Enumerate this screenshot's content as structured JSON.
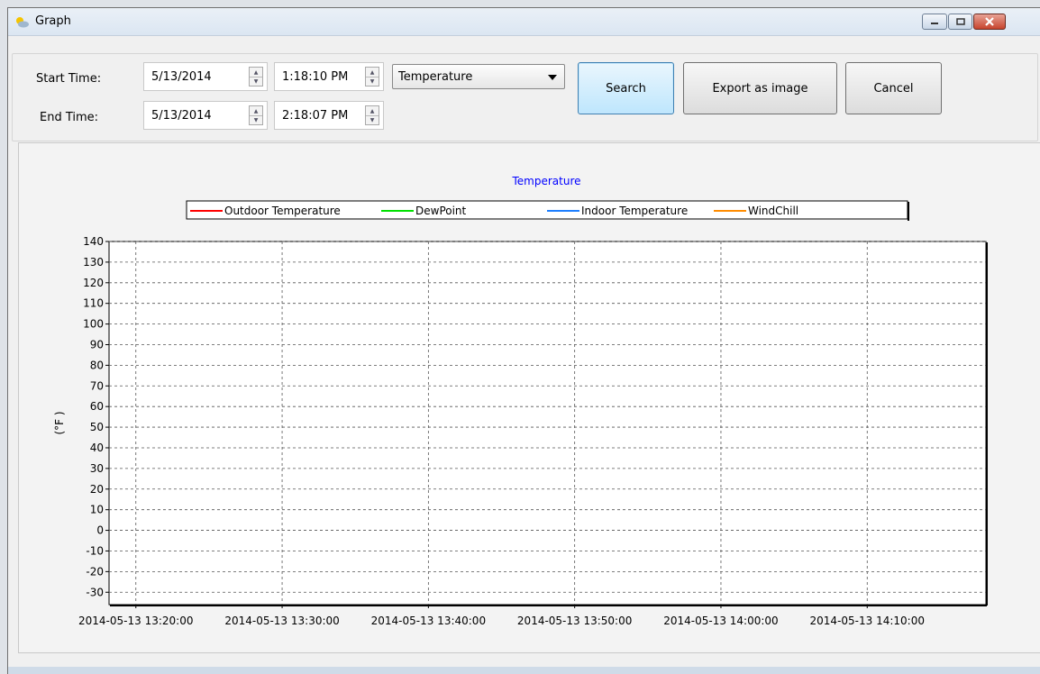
{
  "window": {
    "title": "Graph"
  },
  "controls": {
    "start_label": "Start Time:",
    "end_label": "End Time:",
    "start_date": "5/13/2014",
    "start_time": "1:18:10 PM",
    "end_date": "5/13/2014",
    "end_time": "2:18:07 PM",
    "type_selected": "Temperature",
    "search_label": "Search",
    "export_label": "Export as image",
    "cancel_label": "Cancel"
  },
  "icons": {
    "app": "weather-icon",
    "minimize": "minimize-icon",
    "maximize": "maximize-icon",
    "close": "close-icon",
    "spin_up": "spin-up-icon",
    "spin_down": "spin-down-icon",
    "dropdown": "chevron-down-icon"
  },
  "colors": {
    "title": "#0000ff",
    "close_button": "#c7442d"
  },
  "chart_data": {
    "type": "line",
    "title": "Temperature",
    "ylabel": "(°F )",
    "xlabel": "",
    "ylim": [
      -36,
      140
    ],
    "yticks": [
      140,
      130,
      120,
      110,
      100,
      90,
      80,
      70,
      60,
      50,
      40,
      30,
      20,
      10,
      0,
      -10,
      -20,
      -30
    ],
    "xticks": [
      "2014-05-13 13:20:00",
      "2014-05-13 13:30:00",
      "2014-05-13 13:40:00",
      "2014-05-13 13:50:00",
      "2014-05-13 14:00:00",
      "2014-05-13 14:10:00"
    ],
    "xlim": [
      "2014-05-13 13:18:10",
      "2014-05-13 14:18:07"
    ],
    "grid": true,
    "legend_position": "top",
    "series": [
      {
        "name": "Outdoor Temperature",
        "color": "#ff0000",
        "values": []
      },
      {
        "name": "DewPoint",
        "color": "#00e000",
        "values": []
      },
      {
        "name": "Indoor Temperature",
        "color": "#1e7fff",
        "values": []
      },
      {
        "name": "WindChill",
        "color": "#ff8c00",
        "values": []
      }
    ]
  }
}
